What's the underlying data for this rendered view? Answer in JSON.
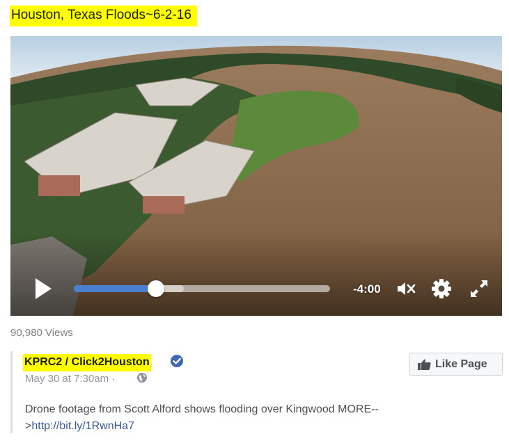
{
  "title": "Houston, Texas Floods~6-2-16",
  "video": {
    "time_remaining": "-4:00",
    "progress": 0.32,
    "buffered": 0.43
  },
  "views": "90,980 Views",
  "post": {
    "page_name": "KPRC2 / Click2Houston",
    "date": "May 30 at 7:30am ·",
    "like_button": "Like Page",
    "description_text": "Drone footage from Scott Alford shows flooding over Kingwood MORE-->",
    "link": "http://bit.ly/1RwnHa7"
  },
  "colors": {
    "highlight": "#ffff00",
    "progress": "#4a7fd0",
    "link": "#365899",
    "verified": "#4267b2"
  },
  "icons": [
    "play-icon",
    "mute-icon",
    "settings-gear-icon",
    "fullscreen-icon",
    "verified-badge-icon",
    "globe-icon",
    "thumbs-up-icon"
  ]
}
